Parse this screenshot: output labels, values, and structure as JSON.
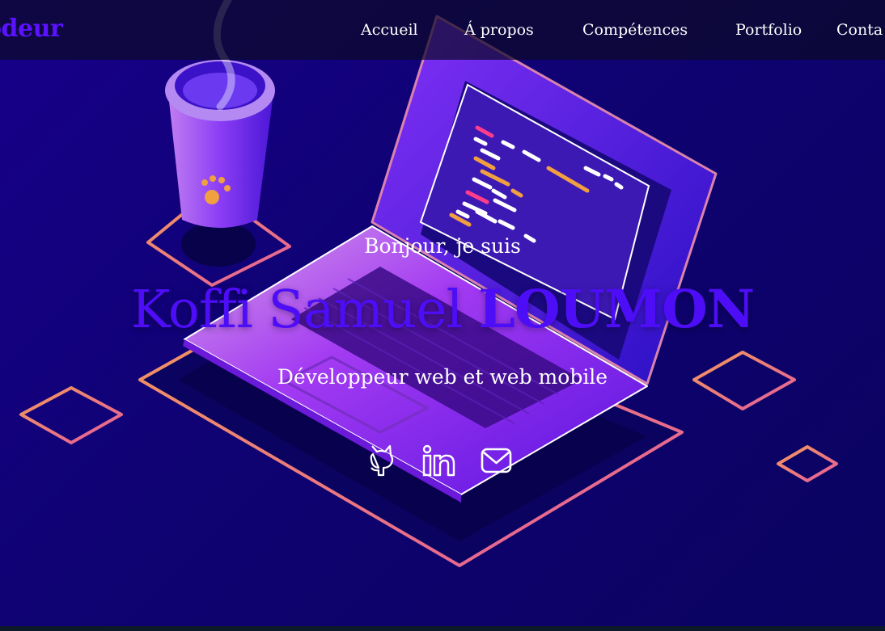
{
  "nav": {
    "logo": "odeur",
    "links": [
      "Accueil",
      "Á propos",
      "Compétences",
      "Portfolio",
      "Conta"
    ]
  },
  "hero": {
    "greeting": "Bonjour, je suis",
    "first_name": "Koffi Samuel",
    "last_name": "LOUMON",
    "role": "Développeur web et web mobile"
  },
  "social": [
    "github-icon",
    "linkedin-icon",
    "mail-icon"
  ],
  "colors": {
    "accent": "#4d0df7",
    "background": "#17008a",
    "outline": "#f07a8a"
  }
}
